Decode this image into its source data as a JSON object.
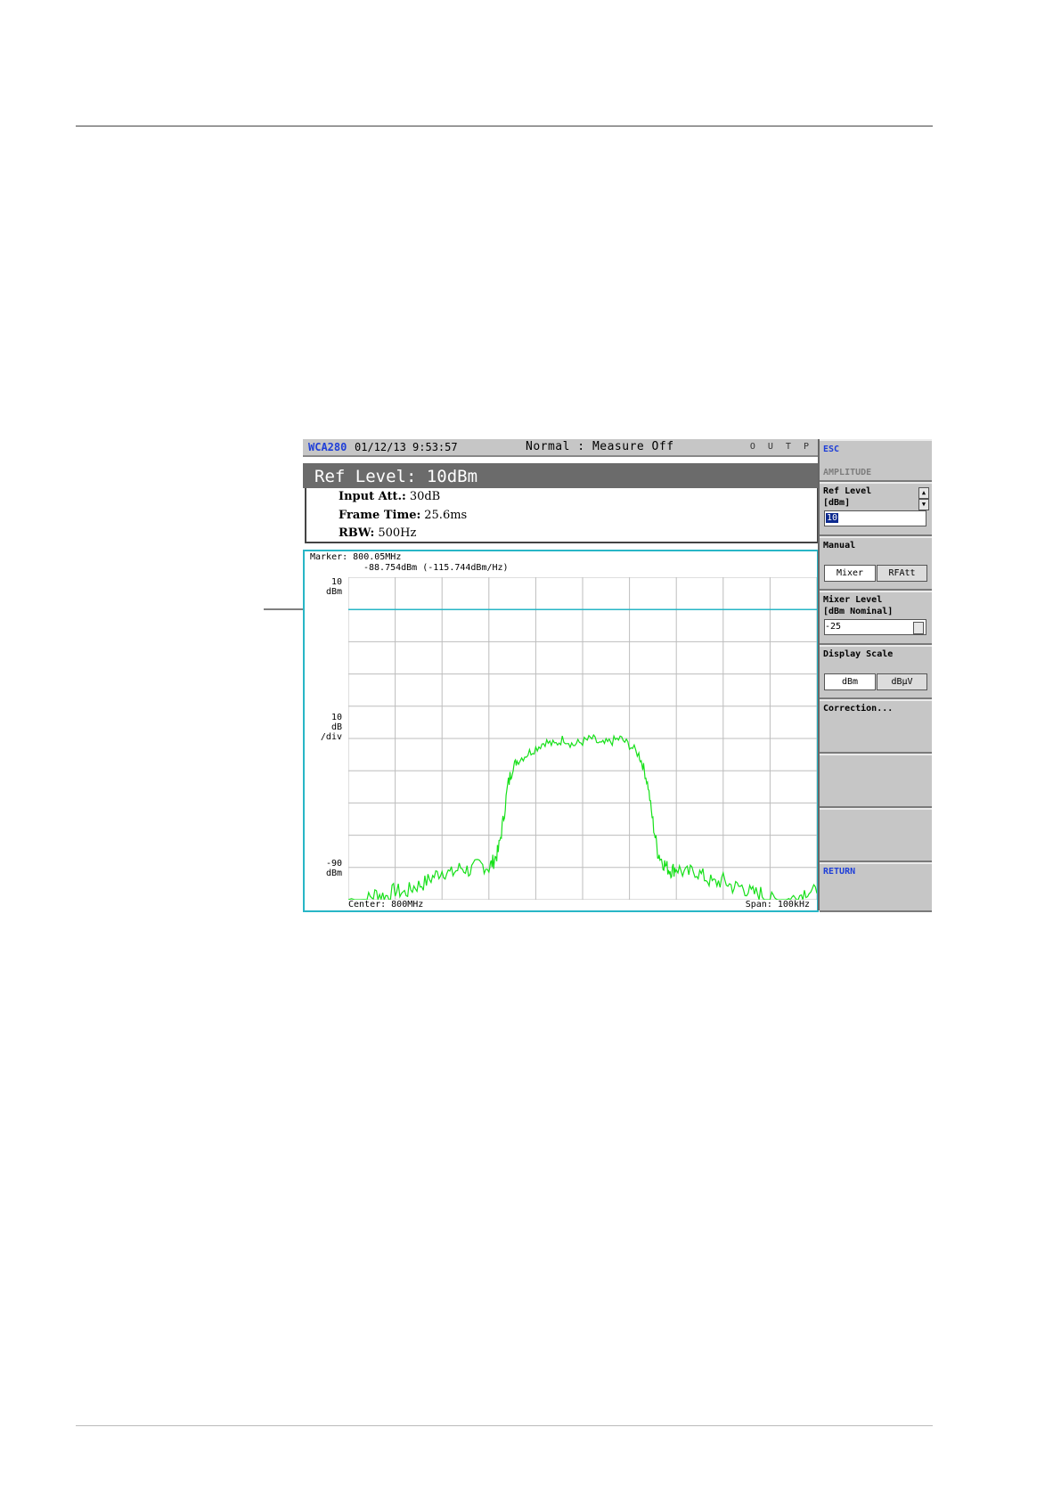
{
  "status_bar": {
    "app": "WCA280",
    "datetime": "01/12/13 9:53:57",
    "mode": "Normal : Measure Off",
    "indicator": "O U T P"
  },
  "header": {
    "ref_level": "Ref Level: 10dBm",
    "params": [
      {
        "label": "Input Att.:",
        "value": "30dB"
      },
      {
        "label": "Frame Time:",
        "value": "25.6ms"
      },
      {
        "label": "RBW:",
        "value": "500Hz"
      }
    ]
  },
  "graph": {
    "marker_line1": "Marker: 800.05MHz",
    "marker_line2": "-88.754dBm (-115.744dBm/Hz)",
    "y_top": [
      "10",
      "dBm"
    ],
    "y_mid": [
      "10",
      "dB",
      "/div"
    ],
    "y_bottom": [
      "-90",
      "dBm"
    ],
    "x_center": "Center: 800MHz",
    "x_span": "Span: 100kHz",
    "trace_color": "#17e01a",
    "ref_line_color": "#28b6c6"
  },
  "side_menu": {
    "esc": "ESC",
    "title": "AMPLITUDE",
    "ref_level": {
      "label1": "Ref Level",
      "label2": "[dBm]",
      "value": "10"
    },
    "manual": {
      "label": "Manual",
      "buttons": [
        "Mixer",
        "RFAtt"
      ]
    },
    "mixer_level": {
      "label1": "Mixer Level",
      "label2": "[dBm Nominal]",
      "value": "-25"
    },
    "display_scale": {
      "label": "Display Scale",
      "buttons": [
        "dBm",
        "dBµV"
      ]
    },
    "correction": "Correction...",
    "return": "RETURN"
  },
  "chart_data": {
    "type": "line",
    "xlabel": "",
    "ylabel": "",
    "x_range_kHz": [
      -50,
      50
    ],
    "ylim": [
      -90,
      10
    ],
    "grid": true,
    "series": [
      {
        "x": [
          -50,
          -46,
          -44,
          -42,
          -40,
          -38,
          -36,
          -34,
          -32,
          -30,
          -28,
          -26,
          -24,
          -22,
          -20,
          -19,
          -18,
          -17,
          -16,
          -15,
          -14,
          -12,
          -10,
          -8,
          -6,
          -4,
          -2,
          0,
          2,
          4,
          6,
          8,
          10,
          12,
          13,
          14,
          15,
          16,
          17,
          18,
          19,
          20,
          22,
          24,
          26,
          28,
          30,
          32,
          34,
          36,
          38,
          40,
          42,
          44,
          46,
          48,
          50
        ],
        "y": [
          -90,
          -90,
          -88,
          -89,
          -87,
          -88,
          -86,
          -85,
          -83,
          -81,
          -82,
          -80,
          -81,
          -79,
          -80,
          -78,
          -75,
          -66,
          -55,
          -49,
          -47,
          -45,
          -43,
          -41,
          -42,
          -40,
          -42,
          -41,
          -40,
          -42,
          -41,
          -40,
          -42,
          -45,
          -49,
          -55,
          -66,
          -75,
          -78,
          -80,
          -81,
          -80,
          -82,
          -81,
          -83,
          -85,
          -84,
          -86,
          -86,
          -88,
          -88,
          -90,
          -90,
          -90,
          -89,
          -87,
          -88
        ]
      }
    ]
  }
}
